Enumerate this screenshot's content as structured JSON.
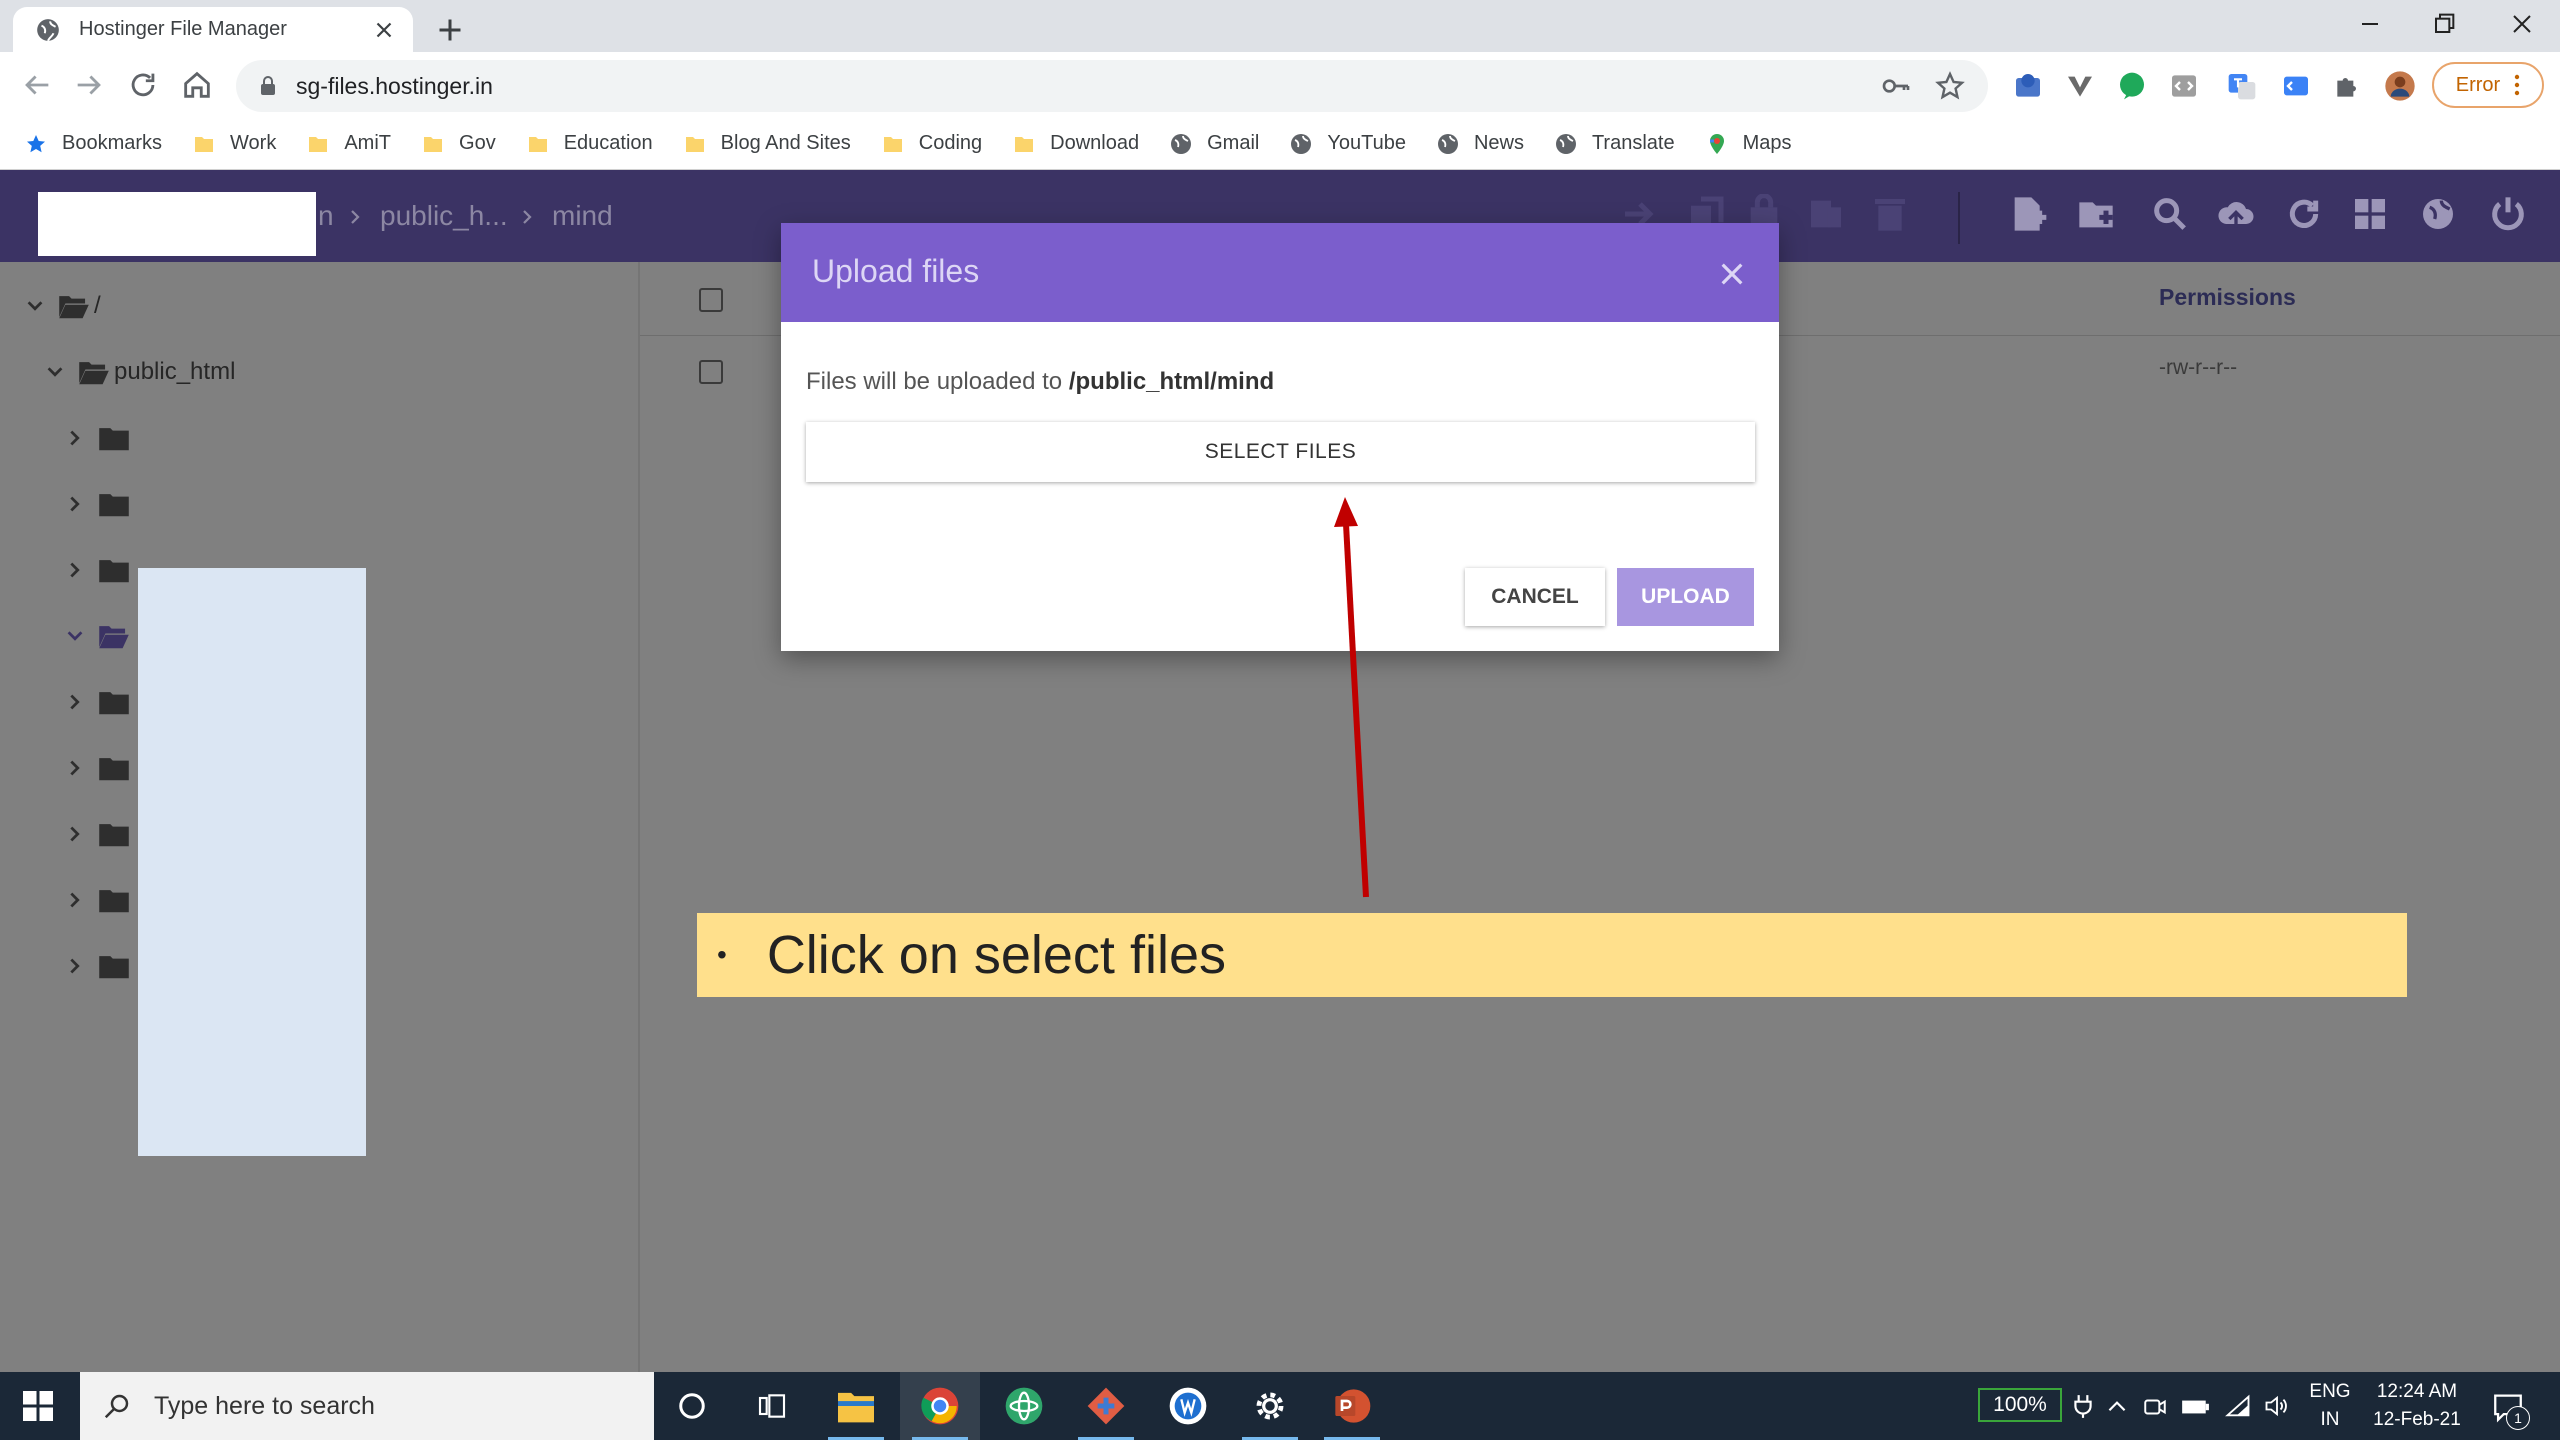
{
  "browser": {
    "tab_title": "Hostinger File Manager",
    "url": "sg-files.hostinger.in",
    "error_label": "Error",
    "bookmarks": [
      {
        "label": "Bookmarks",
        "icon": "star-icon"
      },
      {
        "label": "Work",
        "icon": "folder-icon"
      },
      {
        "label": "AmiT",
        "icon": "folder-icon"
      },
      {
        "label": "Gov",
        "icon": "folder-icon"
      },
      {
        "label": "Education",
        "icon": "folder-icon"
      },
      {
        "label": "Blog And Sites",
        "icon": "folder-icon"
      },
      {
        "label": "Coding",
        "icon": "folder-icon"
      },
      {
        "label": "Download",
        "icon": "folder-icon"
      },
      {
        "label": "Gmail",
        "icon": "globe-icon"
      },
      {
        "label": "YouTube",
        "icon": "globe-icon"
      },
      {
        "label": "News",
        "icon": "globe-icon"
      },
      {
        "label": "Translate",
        "icon": "globe-icon"
      },
      {
        "label": "Maps",
        "icon": "maps-icon"
      }
    ]
  },
  "file_manager": {
    "breadcrumb": {
      "partial": "n",
      "folder1": "public_h...",
      "folder2": "mind"
    },
    "tree": {
      "root_label": "/",
      "public_html_label": "public_html"
    },
    "columns": {
      "permissions": "Permissions"
    },
    "row_permission": "-rw-r--r--"
  },
  "modal": {
    "title": "Upload files",
    "message_prefix": "Files will be uploaded to",
    "target_path": "/public_html/mind",
    "select_label": "SELECT FILES",
    "cancel_label": "CANCEL",
    "upload_label": "UPLOAD"
  },
  "callout": {
    "bullet": "•",
    "text": "Click on select files"
  },
  "taskbar": {
    "search_placeholder": "Type here to search",
    "battery": "100%",
    "lang_top": "ENG",
    "lang_bottom": "IN",
    "time": "12:24 AM",
    "date": "12-Feb-21",
    "notification_count": "1"
  },
  "colors": {
    "header": "#3b3364",
    "modal_header": "#7b5ecc",
    "upload_button": "#a896e0",
    "callout": "#ffe08c",
    "arrow": "#c00000"
  }
}
